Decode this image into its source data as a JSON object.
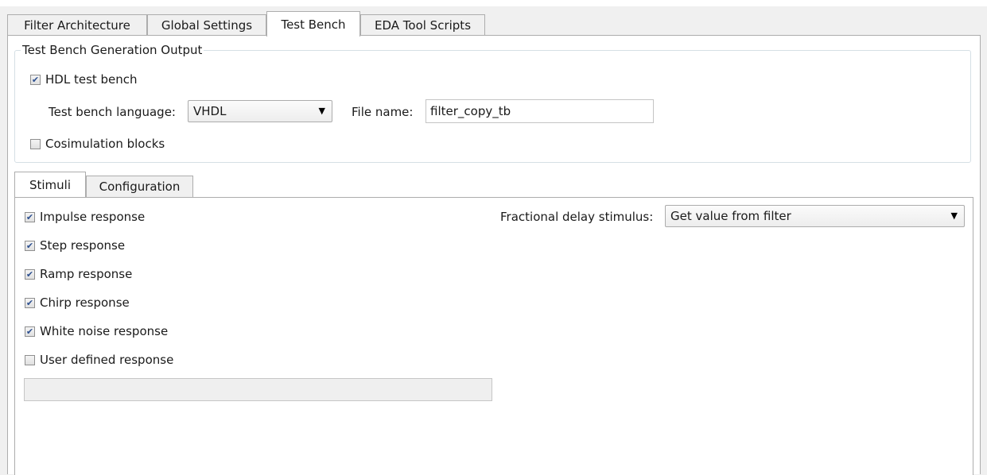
{
  "tabs": {
    "filter_architecture": "Filter Architecture",
    "global_settings": "Global Settings",
    "test_bench": "Test Bench",
    "eda_tool_scripts": "EDA Tool Scripts"
  },
  "generation_output": {
    "legend": "Test Bench Generation Output",
    "hdl_test_bench": {
      "label": "HDL test bench",
      "checked": true
    },
    "language_label": "Test bench language:",
    "language_value": "VHDL",
    "file_name_label": "File name:",
    "file_name_value": "filter_copy_tb",
    "cosimulation": {
      "label": "Cosimulation blocks",
      "checked": false
    }
  },
  "subtabs": {
    "stimuli": "Stimuli",
    "configuration": "Configuration"
  },
  "stimuli": {
    "impulse": {
      "label": "Impulse response",
      "checked": true
    },
    "step": {
      "label": "Step response",
      "checked": true
    },
    "ramp": {
      "label": "Ramp response",
      "checked": true
    },
    "chirp": {
      "label": "Chirp response",
      "checked": true
    },
    "white_noise": {
      "label": "White noise response",
      "checked": true
    },
    "user_defined": {
      "label": "User defined response",
      "checked": false
    },
    "user_defined_value": "",
    "fractional_delay_label": "Fractional delay stimulus:",
    "fractional_delay_value": "Get value from filter"
  },
  "icons": {
    "dropdown": "chevron-down-icon",
    "check": "checkmark-icon"
  },
  "colors": {
    "background": "#f0f0f0",
    "panel": "#ffffff",
    "border": "#adadad",
    "check": "#2c4f8f"
  }
}
